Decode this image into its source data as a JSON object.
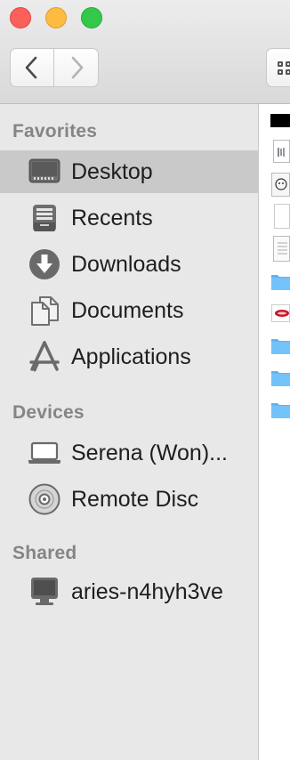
{
  "window": {
    "traffic_lights": [
      "close",
      "minimize",
      "zoom"
    ]
  },
  "toolbar": {
    "back_icon": "chevron-left-icon",
    "forward_icon": "chevron-right-icon",
    "view_icon": "grid-view-icon"
  },
  "sidebar": {
    "favorites_header": "Favorites",
    "favorites": [
      {
        "label": "Desktop",
        "icon": "desktop-icon",
        "selected": true
      },
      {
        "label": "Recents",
        "icon": "recents-icon"
      },
      {
        "label": "Downloads",
        "icon": "downloads-icon"
      },
      {
        "label": "Documents",
        "icon": "documents-icon"
      },
      {
        "label": "Applications",
        "icon": "applications-icon"
      }
    ],
    "devices_header": "Devices",
    "devices": [
      {
        "label": "Serena (Won)...",
        "icon": "laptop-icon"
      },
      {
        "label": "Remote Disc",
        "icon": "disc-icon"
      }
    ],
    "shared_header": "Shared",
    "shared": [
      {
        "label": "aries-n4hyh3ve",
        "icon": "network-computer-icon"
      }
    ]
  },
  "colors": {
    "selection": "#c9c9c9",
    "sidebar_bg": "#e8e8e8",
    "folder_blue": "#5fb4f5",
    "header_gray": "#858585"
  }
}
